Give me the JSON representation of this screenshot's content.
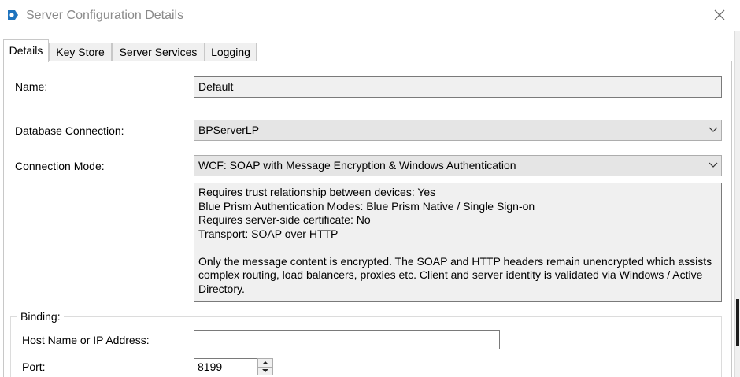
{
  "window": {
    "title": "Server Configuration Details",
    "icon": "blue-prism-logo-icon",
    "close_icon": "close-icon"
  },
  "tabs": [
    {
      "label": "Details",
      "active": true
    },
    {
      "label": "Key Store",
      "active": false
    },
    {
      "label": "Server Services",
      "active": false
    },
    {
      "label": "Logging",
      "active": false
    }
  ],
  "details": {
    "name_label": "Name:",
    "name_value": "Default",
    "db_label": "Database Connection:",
    "db_value": "BPServerLP",
    "mode_label": "Connection Mode:",
    "mode_value": "WCF: SOAP with Message Encryption & Windows Authentication",
    "mode_description": {
      "lines": [
        "Requires trust relationship between devices: Yes",
        "Blue Prism Authentication Modes: Blue Prism Native / Single Sign-on",
        "Requires server-side certificate: No",
        "Transport: SOAP over HTTP"
      ],
      "paragraph": "Only the message content is encrypted. The SOAP and HTTP headers remain unencrypted which assists complex routing, load balancers, proxies etc. Client and server identity is validated via Windows / Active Directory."
    }
  },
  "binding": {
    "group_label": "Binding:",
    "host_label": "Host Name or IP Address:",
    "host_value": "",
    "port_label": "Port:",
    "port_value": "8199"
  },
  "colors": {
    "accent": "#1e73be",
    "readonly_bg": "#f0f0f0",
    "combo_bg": "#e5e5e5",
    "title_text": "#8a8a8a"
  }
}
